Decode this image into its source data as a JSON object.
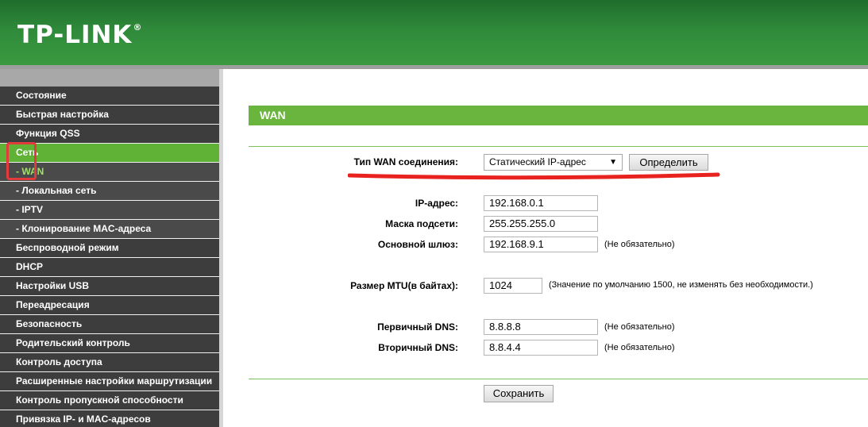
{
  "header": {
    "logo": "TP-LINK",
    "logo_mark": "®"
  },
  "sidebar": {
    "items": [
      {
        "label": "Состояние"
      },
      {
        "label": "Быстрая настройка"
      },
      {
        "label": "Функция QSS"
      },
      {
        "label": "Сеть"
      },
      {
        "label": "- WAN"
      },
      {
        "label": "- Локальная сеть"
      },
      {
        "label": "- IPTV"
      },
      {
        "label": "- Клонирование MAC-адреса"
      },
      {
        "label": "Беспроводной режим"
      },
      {
        "label": "DHCP"
      },
      {
        "label": "Настройки USB"
      },
      {
        "label": "Переадресация"
      },
      {
        "label": "Безопасность"
      },
      {
        "label": "Родительский контроль"
      },
      {
        "label": "Контроль доступа"
      },
      {
        "label": "Расширенные настройки маршрутизации"
      },
      {
        "label": "Контроль пропускной способности"
      },
      {
        "label": "Привязка IP- и MAC-адресов"
      }
    ]
  },
  "main": {
    "section_title": "WAN",
    "wan_type_label": "Тип WAN соединения:",
    "wan_type_value": "Статический IP-адрес",
    "detect_button": "Определить",
    "ip_label": "IP-адрес:",
    "ip_value": "192.168.0.1",
    "mask_label": "Маска подсети:",
    "mask_value": "255.255.255.0",
    "gateway_label": "Основной шлюз:",
    "gateway_value": "192.168.9.1",
    "gateway_note": "(Не обязательно)",
    "mtu_label": "Размер MTU(в байтах):",
    "mtu_value": "1024",
    "mtu_note": "(Значение по умолчанию 1500, не изменять без необходимости.)",
    "dns1_label": "Первичный DNS:",
    "dns1_value": "8.8.8.8",
    "dns1_note": "(Не обязательно)",
    "dns2_label": "Вторичный DNS:",
    "dns2_value": "8.8.4.4",
    "dns2_note": "(Не обязательно)",
    "save_button": "Сохранить"
  },
  "colors": {
    "header_green": "#2f8a3a",
    "accent_green": "#6ab53d",
    "annotation_red": "#e23b3b"
  }
}
